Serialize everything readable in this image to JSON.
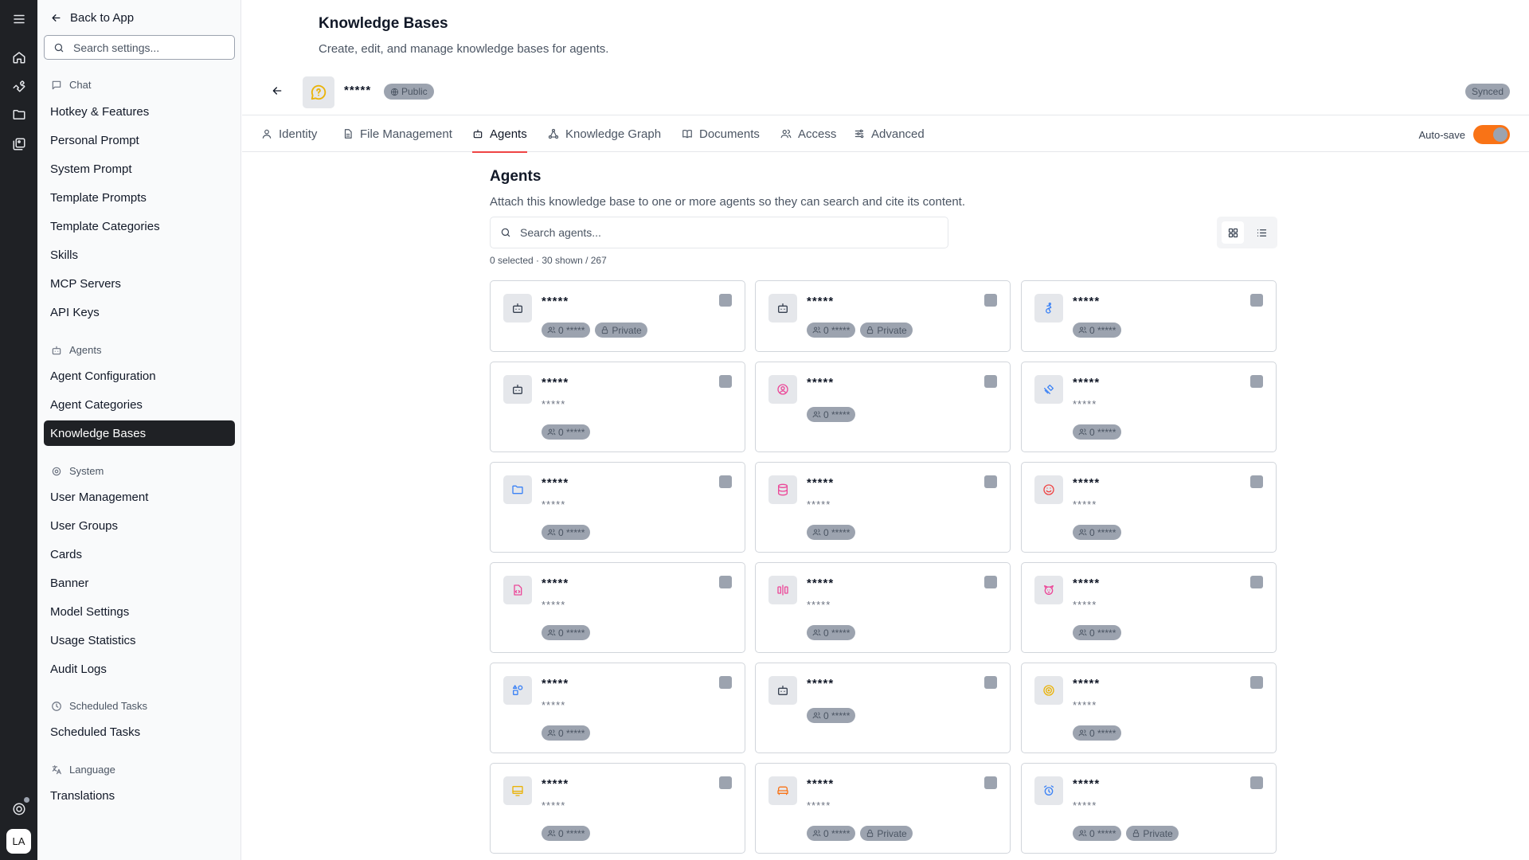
{
  "rail": {
    "avatar": "LA"
  },
  "sidebar": {
    "back_label": "Back to App",
    "search_placeholder": "Search settings...",
    "sections": {
      "chat": "Chat",
      "agents": "Agents",
      "system": "System",
      "scheduled": "Scheduled Tasks",
      "language": "Language"
    },
    "items": {
      "hotkey": "Hotkey & Features",
      "personal_prompt": "Personal Prompt",
      "system_prompt": "System Prompt",
      "template_prompts": "Template Prompts",
      "template_categories": "Template Categories",
      "skills": "Skills",
      "mcp_servers": "MCP Servers",
      "api_keys": "API Keys",
      "agent_configuration": "Agent Configuration",
      "agent_categories": "Agent Categories",
      "knowledge_bases": "Knowledge Bases",
      "user_management": "User Management",
      "user_groups": "User Groups",
      "cards": "Cards",
      "banner": "Banner",
      "model_settings": "Model Settings",
      "usage_statistics": "Usage Statistics",
      "audit_logs": "Audit Logs",
      "scheduled_tasks": "Scheduled Tasks",
      "translations": "Translations"
    }
  },
  "header": {
    "title": "Knowledge Bases",
    "subtitle": "Create, edit, and manage knowledge bases for agents.",
    "kb_name": "*****",
    "kb_visibility": "Public",
    "sync_status": "Synced"
  },
  "tabs": {
    "identity": "Identity",
    "file_management": "File Management",
    "agents": "Agents",
    "knowledge_graph": "Knowledge Graph",
    "documents": "Documents",
    "access": "Access",
    "advanced": "Advanced",
    "autosave_label": "Auto-save"
  },
  "agents_panel": {
    "title": "Agents",
    "subtitle": "Attach this knowledge base to one or more agents so they can search and cite its content.",
    "search_placeholder": "Search agents...",
    "count_text": "0 selected · 30 shown / 267",
    "cards": [
      {
        "name": "*****",
        "desc": "",
        "users": "0 *****",
        "private": "Private",
        "icon": "robot-icon",
        "color": "#374151"
      },
      {
        "name": "*****",
        "desc": "",
        "users": "0 *****",
        "private": "Private",
        "icon": "robot-icon",
        "color": "#374151"
      },
      {
        "name": "*****",
        "desc": "",
        "users": "0 *****",
        "private": "",
        "icon": "accessibility-icon",
        "color": "#3b82f6"
      },
      {
        "name": "*****",
        "desc": "*****",
        "users": "0 *****",
        "private": "",
        "icon": "robot-icon",
        "color": "#374151"
      },
      {
        "name": "*****",
        "desc": "",
        "users": "0 *****",
        "private": "",
        "icon": "user-circle-icon",
        "color": "#ec4899"
      },
      {
        "name": "*****",
        "desc": "*****",
        "users": "0 *****",
        "private": "",
        "icon": "satellite-icon",
        "color": "#3b82f6"
      },
      {
        "name": "*****",
        "desc": "*****",
        "users": "0 *****",
        "private": "",
        "icon": "folder-icon",
        "color": "#3b82f6"
      },
      {
        "name": "*****",
        "desc": "*****",
        "users": "0 *****",
        "private": "",
        "icon": "database-icon",
        "color": "#ec4899"
      },
      {
        "name": "*****",
        "desc": "*****",
        "users": "0 *****",
        "private": "",
        "icon": "smile-icon",
        "color": "#ef4444"
      },
      {
        "name": "*****",
        "desc": "*****",
        "users": "0 *****",
        "private": "",
        "icon": "file-code-icon",
        "color": "#ec4899"
      },
      {
        "name": "*****",
        "desc": "*****",
        "users": "0 *****",
        "private": "",
        "icon": "align-center-icon",
        "color": "#ec4899"
      },
      {
        "name": "*****",
        "desc": "*****",
        "users": "0 *****",
        "private": "",
        "icon": "dog-icon",
        "color": "#ec4899"
      },
      {
        "name": "*****",
        "desc": "*****",
        "users": "0 *****",
        "private": "",
        "icon": "shapes-icon",
        "color": "#3b82f6"
      },
      {
        "name": "*****",
        "desc": "",
        "users": "0 *****",
        "private": "",
        "icon": "robot-icon",
        "color": "#374151"
      },
      {
        "name": "*****",
        "desc": "*****",
        "users": "0 *****",
        "private": "",
        "icon": "target-icon",
        "color": "#eab308"
      },
      {
        "name": "*****",
        "desc": "*****",
        "users": "0 *****",
        "private": "",
        "icon": "monitor-icon",
        "color": "#eab308"
      },
      {
        "name": "*****",
        "desc": "*****",
        "users": "0 *****",
        "private": "Private",
        "icon": "sofa-icon",
        "color": "#f97316"
      },
      {
        "name": "*****",
        "desc": "*****",
        "users": "0 *****",
        "private": "Private",
        "icon": "alarm-clock-icon",
        "color": "#3b82f6"
      }
    ]
  }
}
